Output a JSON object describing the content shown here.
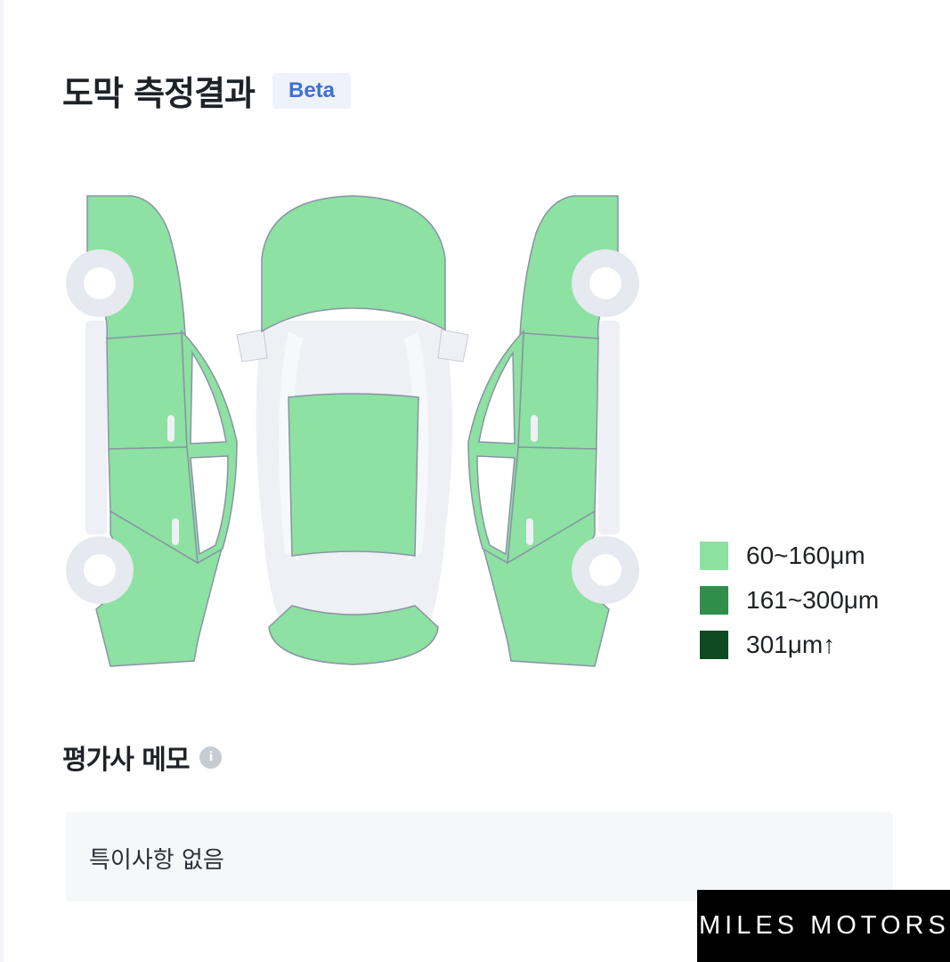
{
  "header": {
    "title": "도막 측정결과",
    "badge": "Beta"
  },
  "colors": {
    "level1": "#8de1a2",
    "level2": "#2f8f4a",
    "level3": "#0f4a22",
    "wheel": "#e6e9ef",
    "outline": "#8a93a6",
    "frame": "#eef0f5"
  },
  "car_panels": {
    "left_side": {
      "front_fender": "level1",
      "front_door": "level1",
      "rear_door": "level1",
      "rear_quarter": "level1"
    },
    "top_view": {
      "hood": "level1",
      "roof": "level1",
      "trunk": "level1"
    },
    "right_side": {
      "front_fender": "level1",
      "front_door": "level1",
      "rear_door": "level1",
      "rear_quarter": "level1"
    }
  },
  "legend": [
    {
      "label": "60~160μm",
      "color": "#8de1a2"
    },
    {
      "label": "161~300μm",
      "color": "#2f8f4a"
    },
    {
      "label": "301μm↑",
      "color": "#0f4a22"
    }
  ],
  "memo": {
    "title": "평가사 메모",
    "info_icon": "info-icon",
    "text": "특이사항 없음"
  },
  "watermark": "MILES MOTORS"
}
